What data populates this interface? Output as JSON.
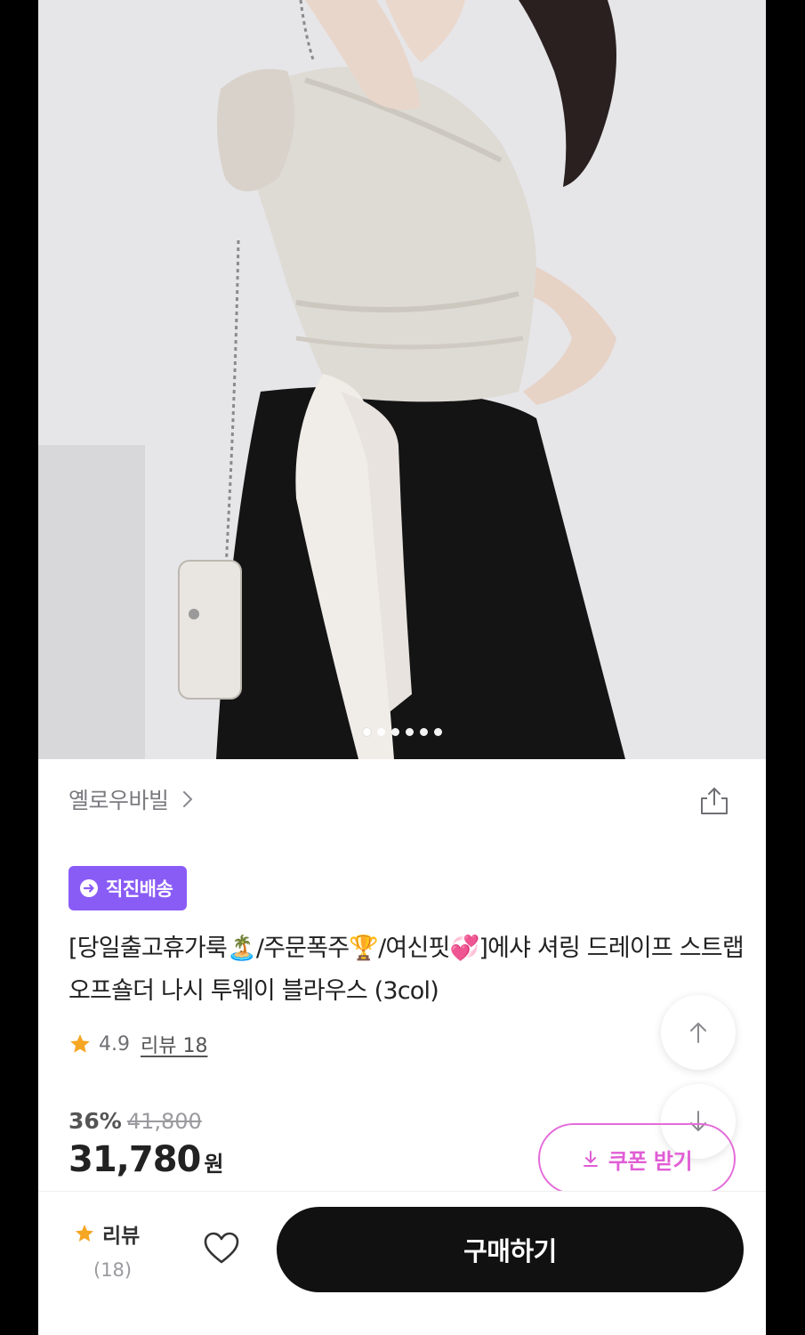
{
  "carousel": {
    "dot_count": 6,
    "active_index": 0
  },
  "store": {
    "name": "옐로우바빌"
  },
  "badge": {
    "label": "직진배송",
    "color": "#8a5cf6"
  },
  "product": {
    "title": "[당일출고휴가룩🏝️/주문폭주🏆/여신핏💞]에샤 셔링 드레이프 스트랩 오프숄더 나시 투웨이 블라우스 (3col)"
  },
  "rating": {
    "score": "4.9",
    "review_label": "리뷰 18"
  },
  "pricing": {
    "discount": "36%",
    "original_price": "41,800",
    "price": "31,780",
    "currency": "원"
  },
  "coupon": {
    "label": "쿠폰 받기",
    "color": "#e05dd5"
  },
  "bottom_bar": {
    "review_label": "리뷰",
    "review_count": "(18)",
    "buy_label": "구매하기"
  },
  "icons": {
    "share": "share-icon",
    "scroll_up": "arrow-up-icon",
    "scroll_down": "arrow-down-icon",
    "wishlist": "heart-icon",
    "star": "star-icon"
  },
  "colors": {
    "star": "#f5a623",
    "buy_button": "#111111",
    "accent": "#8a5cf6"
  }
}
